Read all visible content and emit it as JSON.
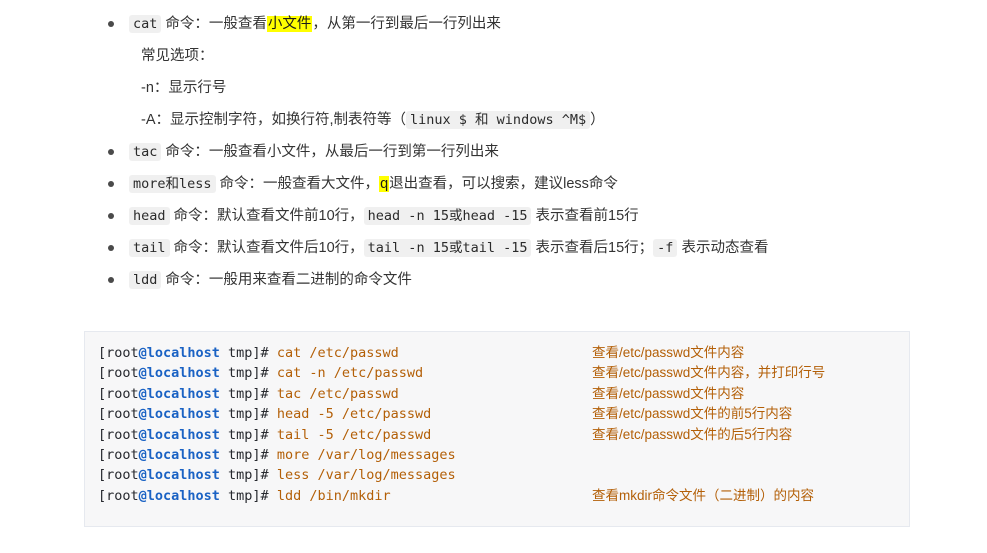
{
  "document": {
    "bullets": [
      {
        "code": "cat",
        "text_before_hl": " 命令：一般查看",
        "highlight": "小文件",
        "text_after_hl": "，从第一行到最后一行列出来",
        "sub_lines": [
          {
            "text": "常见选项："
          },
          {
            "text": "-n：显示行号"
          },
          {
            "prefix": "-A：显示控制字符，如换行符,制表符等（",
            "code": "linux $ 和 windows ^M$",
            "suffix": "）"
          }
        ]
      },
      {
        "code": "tac",
        "text": " 命令：一般查看小文件，从最后一行到第一行列出来"
      },
      {
        "code": "more和less",
        "text_before_hl": " 命令：一般查看大文件，",
        "highlight": "q",
        "text_after_hl": "退出查看，可以搜索，建议less命令"
      },
      {
        "code": "head",
        "text_mid": " 命令：默认查看文件前10行，",
        "code2": "head -n 15或head -15",
        "text_end": " 表示查看前15行"
      },
      {
        "code": "tail",
        "text_mid": " 命令：默认查看文件后10行，",
        "code2": "tail -n 15或tail -15",
        "text_end": " 表示查看后15行；",
        "code3": "-f",
        "text_end2": " 表示动态查看"
      },
      {
        "code": "ldd",
        "text": " 命令：一般用来查看二进制的命令文件"
      }
    ]
  },
  "terminal": {
    "prompt_user": "[root",
    "prompt_host": "@localhost",
    "prompt_tail": " tmp]#",
    "lines": [
      {
        "command": " cat /etc/passwd",
        "comment": "查看/etc/passwd文件内容"
      },
      {
        "command": " cat -n /etc/passwd",
        "comment": "查看/etc/passwd文件内容，并打印行号"
      },
      {
        "command": " tac /etc/passwd",
        "comment": "查看/etc/passwd文件内容"
      },
      {
        "command": " head -5 /etc/passwd",
        "comment": "查看/etc/passwd文件的前5行内容"
      },
      {
        "command": " tail -5 /etc/passwd",
        "comment": "查看/etc/passwd文件的后5行内容"
      },
      {
        "command": " more /var/log/messages",
        "comment": ""
      },
      {
        "command": " less /var/log/messages",
        "comment": ""
      },
      {
        "command": " ldd /bin/mkdir",
        "comment": "查看mkdir命令文件（二进制）的内容"
      }
    ]
  },
  "colors": {
    "prompt_host": "#1a62c4",
    "command": "#b35f07",
    "comment": "#b35f07",
    "highlight": "#ffff00",
    "codeblock_bg": "#f7f7f8",
    "codeblock_border": "#e6e9ef",
    "inline_code_bg": "#f0f0f0"
  }
}
